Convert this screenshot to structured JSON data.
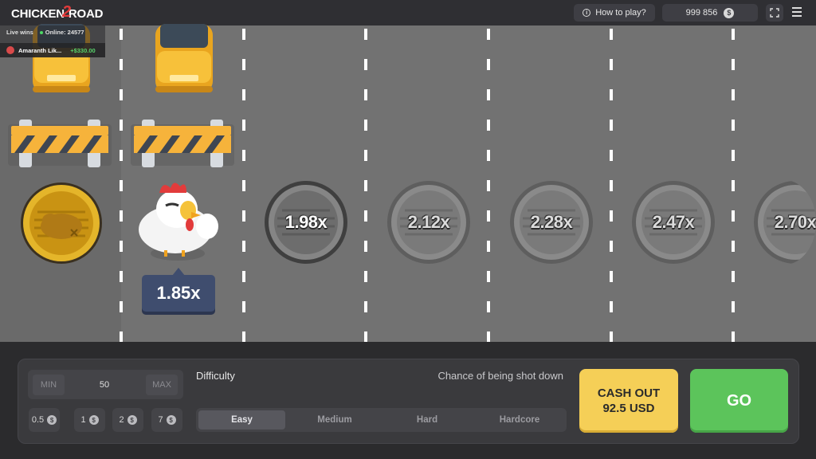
{
  "header": {
    "logo_left": "CHICKEN",
    "logo_mid": "2",
    "logo_right": "ROAD",
    "how_to_play": "How to play?",
    "balance": "999 856",
    "currency_symbol": "$",
    "info_glyph": "i"
  },
  "live_wins": {
    "title": "Live wins",
    "online": "Online: 24577",
    "player": "Amaranth Lik...",
    "amount": "+$330.00"
  },
  "lanes": {
    "current_multiplier": "1.85x",
    "upcoming": [
      "1.98x",
      "2.12x",
      "2.28x",
      "2.47x",
      "2.70x"
    ]
  },
  "bet": {
    "min_label": "MIN",
    "max_label": "MAX",
    "value": "50",
    "chips": [
      "0.5",
      "1",
      "2",
      "7"
    ]
  },
  "difficulty": {
    "label": "Difficulty",
    "chance_label": "Chance of being shot down",
    "options": [
      "Easy",
      "Medium",
      "Hard",
      "Hardcore"
    ],
    "selected": "Easy"
  },
  "actions": {
    "cashout_line1": "CASH OUT",
    "cashout_line2": "92.5 USD",
    "go": "GO"
  },
  "icons": {
    "info": "info-icon",
    "currency": "dollar-coin-icon",
    "fullscreen": "fullscreen-icon",
    "menu": "hamburger-menu-icon",
    "chicken": "chicken-icon",
    "car": "car-icon",
    "barrier": "barrier-icon",
    "manhole": "manhole-icon",
    "roast": "roast-chicken-icon"
  },
  "colors": {
    "cashout": "#f5cf57",
    "go": "#5cc45b",
    "road": "#727272",
    "tag": "#3f4d6e",
    "online_dot": "#4cd964",
    "win_amount": "#58d36b"
  }
}
